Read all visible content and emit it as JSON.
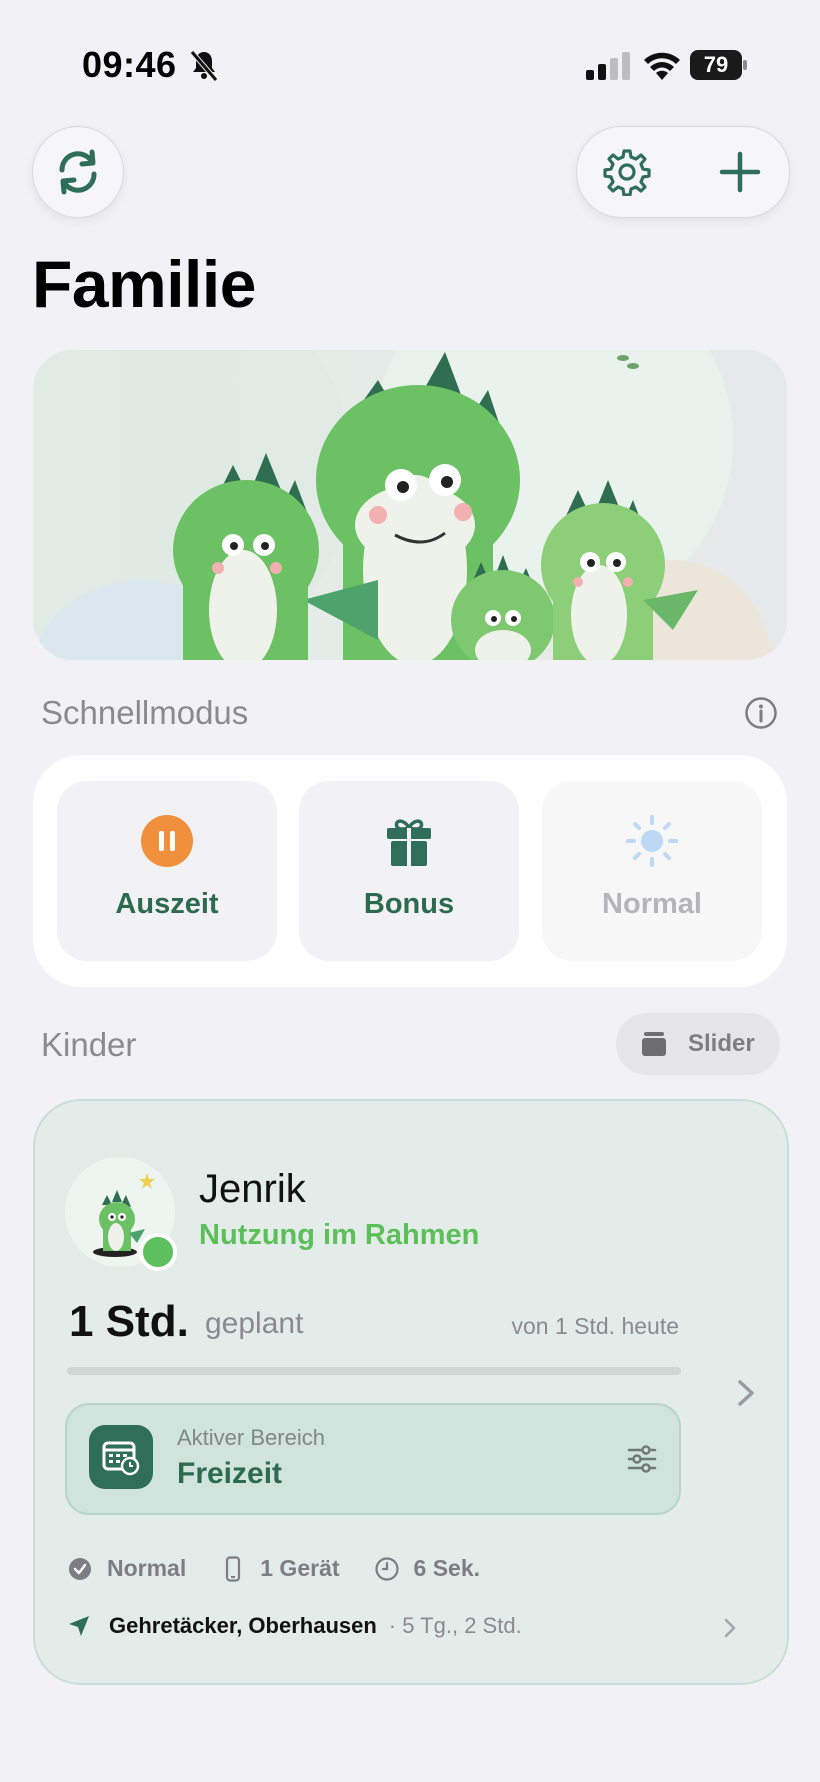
{
  "status_bar": {
    "time": "09:46",
    "battery": "79"
  },
  "page": {
    "title": "Familie"
  },
  "quick_mode": {
    "header": "Schnellmodus",
    "modes": [
      {
        "label": "Auszeit",
        "icon": "pause-icon",
        "color": "#f0903c"
      },
      {
        "label": "Bonus",
        "icon": "gift-icon",
        "color": "#2f6e58"
      },
      {
        "label": "Normal",
        "icon": "sun-icon",
        "color": "#bcd8f4"
      }
    ]
  },
  "children_section": {
    "header": "Kinder",
    "view_toggle": "Slider"
  },
  "child": {
    "name": "Jenrik",
    "status": "Nutzung im Rahmen",
    "planned_time": "1 Std.",
    "planned_label": "geplant",
    "of_today": "von 1 Std. heute",
    "usage_fraction": 0.0,
    "active_area": {
      "kicker": "Aktiver Bereich",
      "value": "Freizeit"
    },
    "meta": {
      "mode": "Normal",
      "devices": "1 Gerät",
      "duration": "6 Sek."
    },
    "location": {
      "place": "Gehretäcker, Oberhausen",
      "since": "· 5 Tg., 2 Std."
    }
  },
  "colors": {
    "accent": "#2f6e58",
    "status_ok": "#5cbf5a",
    "background": "#f2f2f6"
  }
}
